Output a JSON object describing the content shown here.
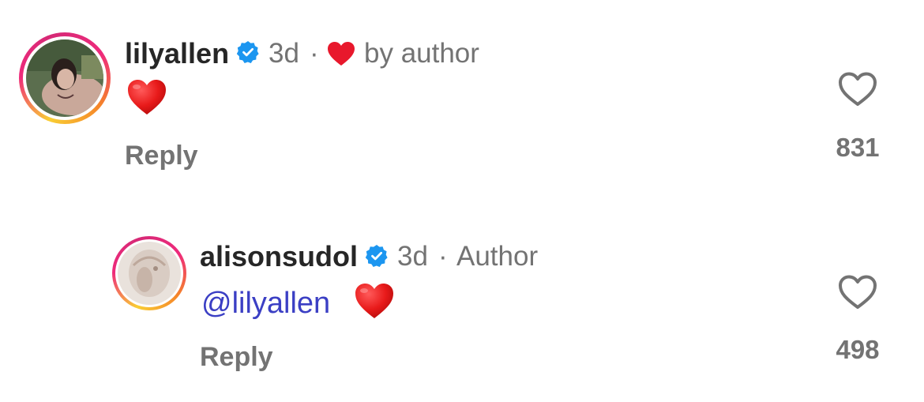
{
  "comments": [
    {
      "username": "lilyallen",
      "time": "3d",
      "separator": "·",
      "badge_text": "by author",
      "body_emoji": "❤️",
      "reply_label": "Reply",
      "like_count": "831"
    },
    {
      "username": "alisonsudol",
      "time": "3d",
      "separator": "·",
      "badge_text": "Author",
      "mention": "@lilyallen",
      "body_emoji": "❤️",
      "reply_label": "Reply",
      "like_count": "498"
    }
  ],
  "icons": {
    "verified": "verified-badge-icon",
    "like": "heart-outline-icon",
    "liked_by_author": "red-heart-icon"
  },
  "colors": {
    "verified_blue": "#1c96f0",
    "heart_red": "#e8182c",
    "mention_blue": "#3b3fc4",
    "secondary_text": "#737373"
  }
}
